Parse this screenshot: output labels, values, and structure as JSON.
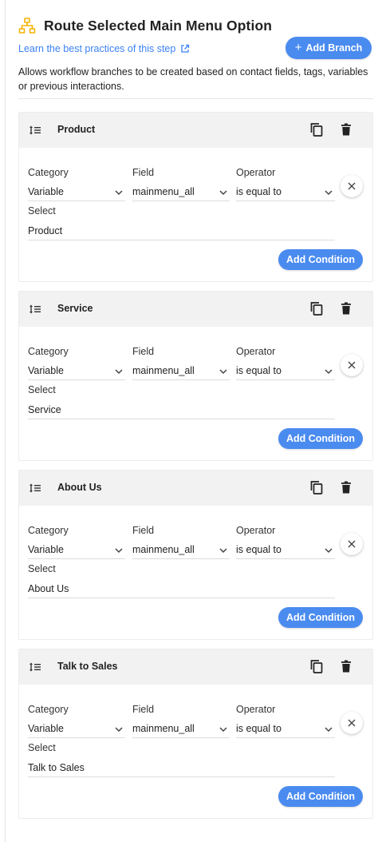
{
  "header": {
    "title": "Route Selected Main Menu Option",
    "learn_link": "Learn the best practices of this step",
    "add_branch_label": "Add Branch",
    "description": "Allows workflow branches to be created based on contact fields, tags, variables or previous interactions."
  },
  "labels": {
    "category": "Category",
    "field": "Field",
    "operator": "Operator",
    "select": "Select",
    "add_condition": "Add Condition"
  },
  "branches": [
    {
      "name": "Product",
      "category": "Variable",
      "field": "mainmenu_all",
      "operator": "is equal to",
      "select": "Product"
    },
    {
      "name": "Service",
      "category": "Variable",
      "field": "mainmenu_all",
      "operator": "is equal to",
      "select": "Service"
    },
    {
      "name": "About Us",
      "category": "Variable",
      "field": "mainmenu_all",
      "operator": "is equal to",
      "select": "About Us"
    },
    {
      "name": "Talk to Sales",
      "category": "Variable",
      "field": "mainmenu_all",
      "operator": "is equal to",
      "select": "Talk to Sales"
    }
  ],
  "colors": {
    "accent": "#4a8bf0",
    "link": "#3b82f6",
    "workflow_icon": "#f5b301",
    "branch_header_bg": "#f2f2f2"
  },
  "icons": {
    "title": "workflow-tree-icon",
    "learn_link": "external-link-icon",
    "branch_drag": "list-order-icon",
    "branch_copy": "copy-icon",
    "branch_delete": "trash-icon",
    "dropdown": "chevron-down-icon",
    "remove_condition": "close-icon"
  }
}
